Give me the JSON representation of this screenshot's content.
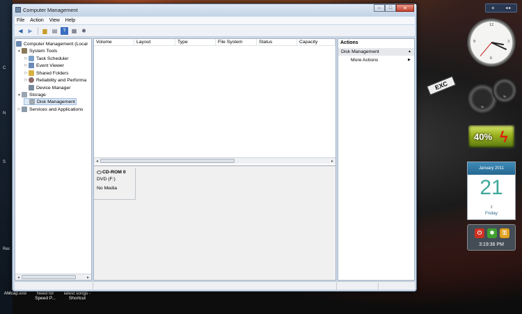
{
  "window": {
    "title": "Computer Management"
  },
  "menu": [
    "File",
    "Action",
    "View",
    "Help"
  ],
  "tree": [
    {
      "label": "Computer Management (Local",
      "indent": 0,
      "expander": "",
      "icon": "computer"
    },
    {
      "label": "System Tools",
      "indent": 1,
      "expander": "▲",
      "icon": "tools"
    },
    {
      "label": "Task Scheduler",
      "indent": 2,
      "expander": "▷",
      "icon": "scheduler"
    },
    {
      "label": "Event Viewer",
      "indent": 2,
      "expander": "▷",
      "icon": "event"
    },
    {
      "label": "Shared Folders",
      "indent": 2,
      "expander": "▷",
      "icon": "folder"
    },
    {
      "label": "Reliability and Performa",
      "indent": 2,
      "expander": "▷",
      "icon": "reliability"
    },
    {
      "label": "Device Manager",
      "indent": 2,
      "expander": "",
      "icon": "device"
    },
    {
      "label": "Storage",
      "indent": 1,
      "expander": "▲",
      "icon": "storage"
    },
    {
      "label": "Disk Management",
      "indent": 2,
      "expander": "",
      "icon": "disk",
      "selected": true
    },
    {
      "label": "Services and Applications",
      "indent": 1,
      "expander": "▷",
      "icon": "services"
    }
  ],
  "columns": [
    "Volume",
    "Layout",
    "Type",
    "File System",
    "Status",
    "Capacity"
  ],
  "disk": {
    "name": "CD-ROM 0",
    "type": "DVD (F:)",
    "media": "No Media"
  },
  "actions": {
    "title": "Actions",
    "section": "Disk Management",
    "more": "More Actions"
  },
  "gadgets": {
    "battery_percent": "40%",
    "calendar_month": "January 2011",
    "calendar_day": "21",
    "calendar_weekday": "Friday",
    "calendar_mark": "3",
    "time": "3:19:36 PM",
    "car_label": "EXC"
  },
  "desktop": {
    "icon1": "AMcap.exe",
    "icon2": "Need for Speed P...",
    "icon3": "latest songs - Shortcut"
  }
}
